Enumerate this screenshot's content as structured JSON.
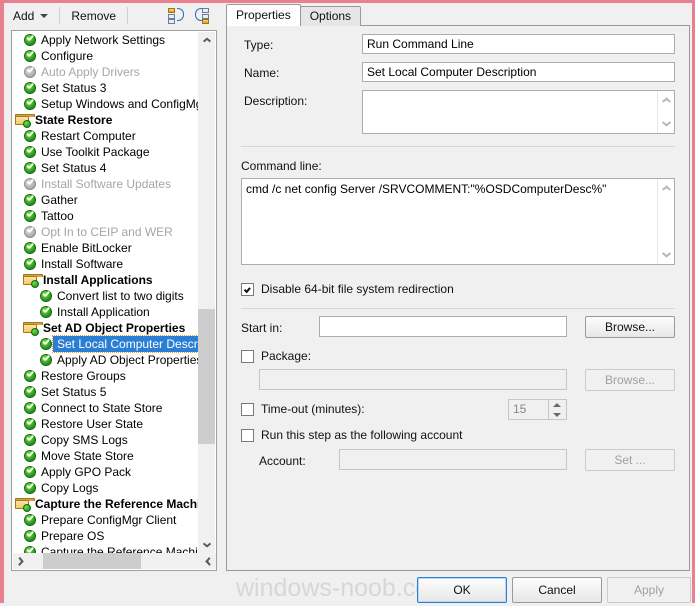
{
  "window": {
    "accent_border": "#e8808f"
  },
  "toolbar": {
    "add_label": "Add",
    "remove_label": "Remove",
    "icons": [
      {
        "name": "move-group-down-icon",
        "title": "Move Down"
      },
      {
        "name": "move-group-up-icon",
        "title": "Move Up"
      }
    ]
  },
  "tree": {
    "items": [
      {
        "label": "Apply Network Settings",
        "type": "step",
        "indent": 1,
        "enabled": true,
        "selected": false
      },
      {
        "label": "Configure",
        "type": "step",
        "indent": 1,
        "enabled": true,
        "selected": false
      },
      {
        "label": "Auto Apply Drivers",
        "type": "step",
        "indent": 1,
        "enabled": false,
        "selected": false
      },
      {
        "label": "Set Status 3",
        "type": "step",
        "indent": 1,
        "enabled": true,
        "selected": false
      },
      {
        "label": "Setup Windows and ConfigMgr",
        "type": "step",
        "indent": 1,
        "enabled": true,
        "selected": false
      },
      {
        "label": "State Restore",
        "type": "group",
        "indent": 0,
        "enabled": true,
        "selected": false
      },
      {
        "label": "Restart Computer",
        "type": "step",
        "indent": 1,
        "enabled": true,
        "selected": false
      },
      {
        "label": "Use Toolkit Package",
        "type": "step",
        "indent": 1,
        "enabled": true,
        "selected": false
      },
      {
        "label": "Set Status 4",
        "type": "step",
        "indent": 1,
        "enabled": true,
        "selected": false
      },
      {
        "label": "Install Software Updates",
        "type": "step",
        "indent": 1,
        "enabled": false,
        "selected": false
      },
      {
        "label": "Gather",
        "type": "step",
        "indent": 1,
        "enabled": true,
        "selected": false
      },
      {
        "label": "Tattoo",
        "type": "step",
        "indent": 1,
        "enabled": true,
        "selected": false
      },
      {
        "label": "Opt In to CEIP and WER",
        "type": "step",
        "indent": 1,
        "enabled": false,
        "selected": false
      },
      {
        "label": "Enable BitLocker",
        "type": "step",
        "indent": 1,
        "enabled": true,
        "selected": false
      },
      {
        "label": "Install Software",
        "type": "step",
        "indent": 1,
        "enabled": true,
        "selected": false
      },
      {
        "label": "Install Applications",
        "type": "group",
        "indent": 1,
        "enabled": true,
        "selected": false
      },
      {
        "label": "Convert list to two digits",
        "type": "step",
        "indent": 2,
        "enabled": true,
        "selected": false
      },
      {
        "label": "Install Application",
        "type": "step",
        "indent": 2,
        "enabled": true,
        "selected": false
      },
      {
        "label": "Set AD Object Properties",
        "type": "group",
        "indent": 1,
        "enabled": true,
        "selected": false
      },
      {
        "label": "Set Local Computer Description",
        "type": "step",
        "indent": 2,
        "enabled": true,
        "selected": true
      },
      {
        "label": "Apply AD Object Properties",
        "type": "step",
        "indent": 2,
        "enabled": true,
        "selected": false
      },
      {
        "label": "Restore Groups",
        "type": "step",
        "indent": 1,
        "enabled": true,
        "selected": false
      },
      {
        "label": "Set Status 5",
        "type": "step",
        "indent": 1,
        "enabled": true,
        "selected": false
      },
      {
        "label": "Connect to State Store",
        "type": "step",
        "indent": 1,
        "enabled": true,
        "selected": false
      },
      {
        "label": "Restore User State",
        "type": "step",
        "indent": 1,
        "enabled": true,
        "selected": false
      },
      {
        "label": "Copy SMS Logs",
        "type": "step",
        "indent": 1,
        "enabled": true,
        "selected": false
      },
      {
        "label": "Move State Store",
        "type": "step",
        "indent": 1,
        "enabled": true,
        "selected": false
      },
      {
        "label": "Apply GPO Pack",
        "type": "step",
        "indent": 1,
        "enabled": true,
        "selected": false
      },
      {
        "label": "Copy Logs",
        "type": "step",
        "indent": 1,
        "enabled": true,
        "selected": false
      },
      {
        "label": "Capture the Reference Machine",
        "type": "group",
        "indent": 0,
        "enabled": true,
        "selected": false
      },
      {
        "label": "Prepare ConfigMgr Client",
        "type": "step",
        "indent": 1,
        "enabled": true,
        "selected": false
      },
      {
        "label": "Prepare OS",
        "type": "step",
        "indent": 1,
        "enabled": true,
        "selected": false
      },
      {
        "label": "Capture the Reference Machine",
        "type": "step",
        "indent": 1,
        "enabled": true,
        "selected": false
      }
    ]
  },
  "tabs": [
    {
      "label": "Properties",
      "active": true
    },
    {
      "label": "Options",
      "active": false
    }
  ],
  "form": {
    "type_label": "Type:",
    "type_value": "Run Command Line",
    "name_label": "Name:",
    "name_value": "Set Local Computer Description",
    "description_label": "Description:",
    "description_value": "",
    "command_line_label": "Command line:",
    "command_line_value": "cmd /c net config Server /SRVCOMMENT:\"%OSDComputerDesc%\"",
    "disable_redirection_label": "Disable 64-bit file system redirection",
    "disable_redirection_checked": true,
    "start_in_label": "Start in:",
    "start_in_value": "",
    "start_in_browse_label": "Browse...",
    "package_label": "Package:",
    "package_checked": false,
    "package_value": "",
    "package_browse_label": "Browse...",
    "timeout_label": "Time-out (minutes):",
    "timeout_checked": false,
    "timeout_value": "15",
    "run_as_label": "Run this step as the following account",
    "run_as_checked": false,
    "account_label": "Account:",
    "account_value": "",
    "account_set_label": "Set ..."
  },
  "footer": {
    "ok_label": "OK",
    "cancel_label": "Cancel",
    "apply_label": "Apply",
    "watermark": "windows-noob.com"
  }
}
